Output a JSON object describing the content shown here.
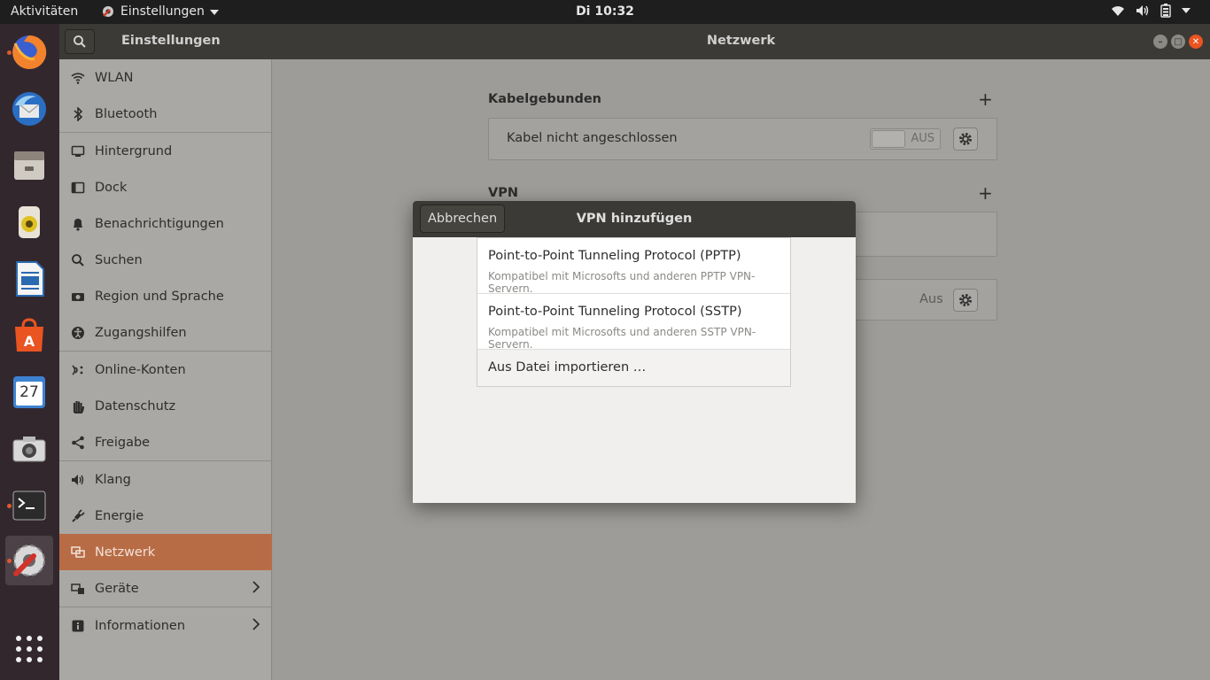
{
  "topbar": {
    "activities": "Aktivitäten",
    "app_menu": "Einstellungen",
    "clock": "Di 10:32"
  },
  "dock": {
    "apps": [
      {
        "name": "firefox-icon",
        "running": true
      },
      {
        "name": "thunderbird-icon",
        "running": false
      },
      {
        "name": "files-icon",
        "running": false
      },
      {
        "name": "rhythmbox-icon",
        "running": false
      },
      {
        "name": "writer-icon",
        "running": false
      },
      {
        "name": "software-icon",
        "running": false
      },
      {
        "name": "calendar-icon",
        "running": false,
        "label": "27"
      },
      {
        "name": "camera-icon",
        "running": false
      },
      {
        "name": "terminal-icon",
        "running": true
      },
      {
        "name": "settings-icon",
        "running": true
      },
      {
        "name": "app-grid-icon",
        "running": false
      }
    ]
  },
  "header": {
    "sidebar_title": "Einstellungen",
    "main_title": "Netzwerk"
  },
  "sidebar": {
    "items": [
      {
        "label": "WLAN",
        "icon": "wifi-icon"
      },
      {
        "label": "Bluetooth",
        "icon": "bluetooth-icon"
      },
      {
        "label": "Hintergrund",
        "icon": "background-icon"
      },
      {
        "label": "Dock",
        "icon": "dock-icon"
      },
      {
        "label": "Benachrichtigungen",
        "icon": "bell-icon"
      },
      {
        "label": "Suchen",
        "icon": "search-icon"
      },
      {
        "label": "Region und Sprache",
        "icon": "camera-region-icon"
      },
      {
        "label": "Zugangshilfen",
        "icon": "accessibility-icon"
      },
      {
        "label": "Online-Konten",
        "icon": "online-accounts-icon"
      },
      {
        "label": "Datenschutz",
        "icon": "hand-icon"
      },
      {
        "label": "Freigabe",
        "icon": "share-icon"
      },
      {
        "label": "Klang",
        "icon": "speaker-icon"
      },
      {
        "label": "Energie",
        "icon": "power-plug-icon"
      },
      {
        "label": "Netzwerk",
        "icon": "network-icon",
        "selected": true
      },
      {
        "label": "Geräte",
        "icon": "devices-icon",
        "chevron": true
      },
      {
        "label": "Informationen",
        "icon": "info-icon",
        "chevron": true
      }
    ]
  },
  "main": {
    "wired_title": "Kabelgebunden",
    "wired_status": "Kabel nicht angeschlossen",
    "wired_toggle": "AUS",
    "vpn_title": "VPN",
    "proxy_state": "Aus"
  },
  "dialog": {
    "cancel": "Abbrechen",
    "title": "VPN hinzufügen",
    "options": [
      {
        "title": "Point-to-Point Tunneling Protocol (PPTP)",
        "subtitle": "Kompatibel mit Microsofts und anderen PPTP VPN-Servern."
      },
      {
        "title": "Point-to-Point Tunneling Protocol (SSTP)",
        "subtitle": "Kompatibel mit Microsofts und anderen SSTP VPN-Servern."
      }
    ],
    "import": "Aus Datei importieren …"
  },
  "colors": {
    "accent": "#e95420",
    "selected_row": "#b86c45",
    "close_button": "#e95420"
  }
}
